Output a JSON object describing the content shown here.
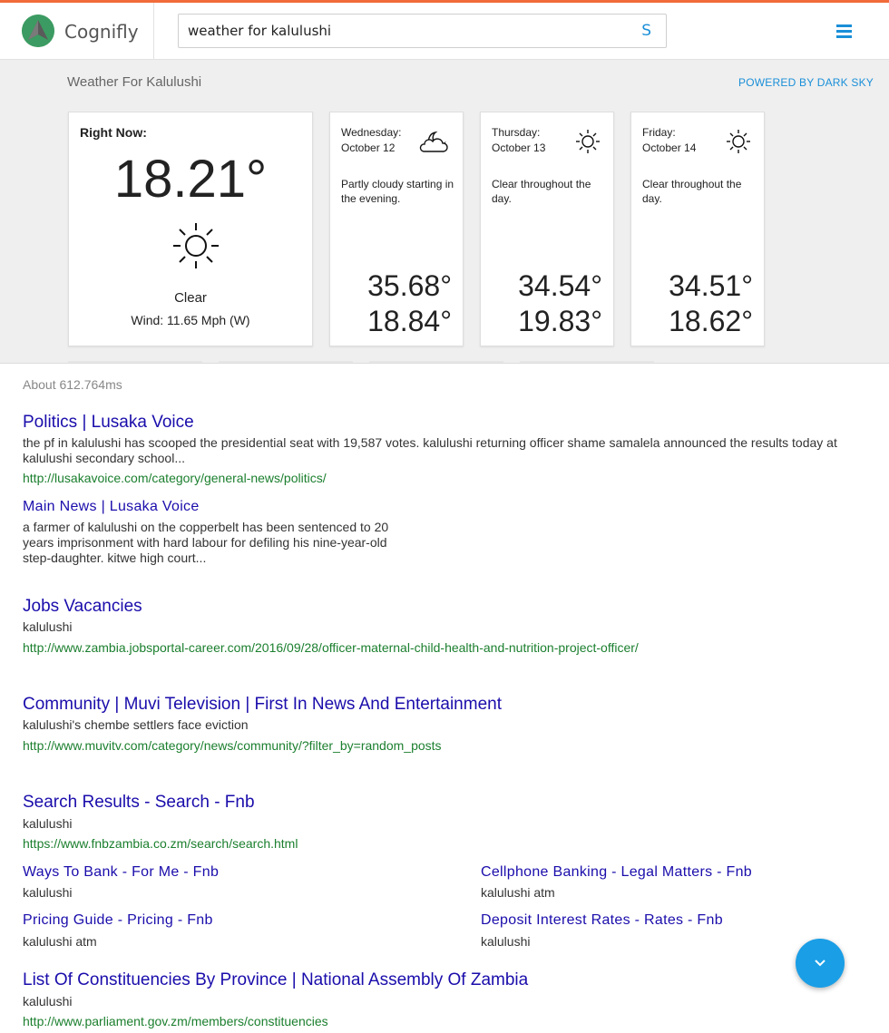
{
  "header": {
    "brand": "Cognifly",
    "search_value": "weather for kalulushi",
    "search_button": "S",
    "menu_icon": "hamburger-menu-icon",
    "logo_icon": "cognifly-logo-icon"
  },
  "weather": {
    "title": "Weather For Kalulushi",
    "powered_by": "POWERED BY DARK SKY",
    "now": {
      "label": "Right Now:",
      "temperature": "18.21°",
      "icon": "sun-icon",
      "condition": "Clear",
      "wind": "Wind: 11.65 Mph (W)"
    },
    "days": [
      {
        "day": "Wednesday:",
        "date": "October 12",
        "icon": "partly-cloudy-night-icon",
        "summary": "Partly cloudy starting in the evening.",
        "high": "35.68°",
        "low": "18.84°"
      },
      {
        "day": "Thursday:",
        "date": "October 13",
        "icon": "sun-icon",
        "summary": "Clear throughout the day.",
        "high": "34.54°",
        "low": "19.83°"
      },
      {
        "day": "Friday:",
        "date": "October 14",
        "icon": "sun-icon",
        "summary": "Clear throughout the day.",
        "high": "34.51°",
        "low": "18.62°"
      }
    ]
  },
  "results": {
    "about": "About 612.764ms",
    "items": [
      {
        "title": "Politics | Lusaka Voice",
        "snippet": "the pf in kalulushi has scooped the presidential seat with 19,587 votes. kalulushi returning officer shame samalela announced the results today at kalulushi secondary school...",
        "url": "http://lusakavoice.com/category/general-news/politics/"
      },
      {
        "title": "Main News | Lusaka Voice",
        "snippet": "a farmer of kalulushi on the copperbelt has been sentenced to 20 years imprisonment with hard labour for defiling his nine-year-old step-daughter. kitwe high court..."
      },
      {
        "title": "Jobs Vacancies",
        "snippet": "kalulushi",
        "url": "http://www.zambia.jobsportal-career.com/2016/09/28/officer-maternal-child-health-and-nutrition-project-officer/"
      },
      {
        "title": "Community | Muvi Television | First In News And Entertainment",
        "snippet": "kalulushi's chembe settlers face eviction",
        "url": "http://www.muvitv.com/category/news/community/?filter_by=random_posts"
      },
      {
        "title": "Search Results - Search - Fnb",
        "snippet": "kalulushi",
        "url": "https://www.fnbzambia.co.zm/search/search.html"
      }
    ],
    "sitelinks": [
      {
        "title": "Ways To Bank - For Me - Fnb",
        "snippet": "kalulushi"
      },
      {
        "title": "Cellphone Banking - Legal Matters - Fnb",
        "snippet": "kalulushi atm"
      },
      {
        "title": "Pricing Guide - Pricing - Fnb",
        "snippet": "kalulushi atm"
      },
      {
        "title": "Deposit Interest Rates - Rates - Fnb",
        "snippet": "kalulushi"
      }
    ],
    "last": {
      "title": "List Of Constituencies By Province | National Assembly Of Zambia",
      "snippet": "kalulushi",
      "url": "http://www.parliament.gov.zm/members/constituencies"
    }
  },
  "fab": {
    "icon": "chevron-down-icon"
  }
}
